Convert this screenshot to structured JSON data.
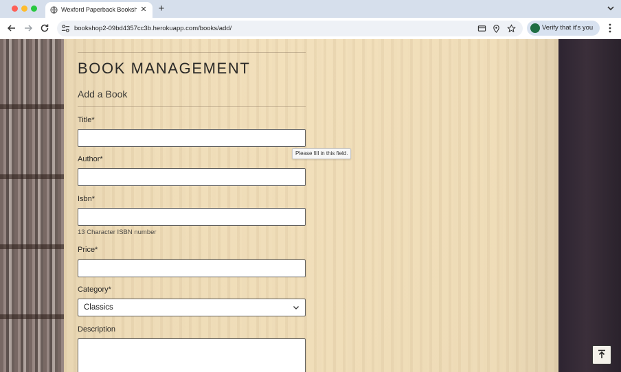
{
  "browser": {
    "tab_title": "Wexford Paperback Bookshop",
    "url": "bookshop2-09bd4357cc3b.herokuapp.com/books/add/",
    "verify_label": "Verify that it's you"
  },
  "page": {
    "heading": "BOOK MANAGEMENT",
    "subheading": "Add a Book",
    "fields": {
      "title_label": "Title*",
      "author_label": "Author*",
      "isbn_label": "Isbn*",
      "isbn_help": "13 Character ISBN number",
      "price_label": "Price*",
      "category_label": "Category*",
      "category_value": "Classics",
      "description_label": "Description"
    },
    "validation_tooltip": "Please fill in this field."
  }
}
